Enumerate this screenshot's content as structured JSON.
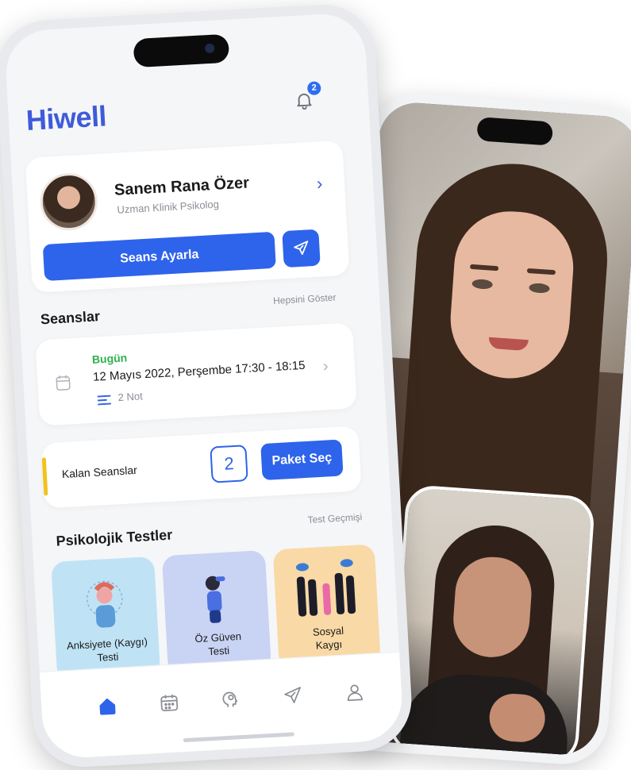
{
  "app": {
    "logo": "Hiwell",
    "notification_count": "2"
  },
  "psychologist": {
    "name": "Sanem Rana Özer",
    "title": "Uzman Klinik Psikolog",
    "chevron": "›"
  },
  "actions": {
    "schedule_label": "Seans Ayarla",
    "send_icon": "send-icon"
  },
  "sessions": {
    "title": "Seanslar",
    "see_all": "Hepsini Göster",
    "next": {
      "day_label": "Bugün",
      "date_time": "12 Mayıs 2022, Perşembe 17:30 - 18:15",
      "notes": "2 Not",
      "chevron": "›"
    }
  },
  "remaining": {
    "label": "Kalan Seanslar",
    "count": "2",
    "package_button": "Paket Seç"
  },
  "tests": {
    "title": "Psikolojik Testler",
    "history_link": "Test Geçmişi",
    "items": [
      {
        "label_line1": "Anksiyete (Kaygı)",
        "label_line2": "Testi",
        "color": "#bfe3f5"
      },
      {
        "label_line1": "Öz Güven",
        "label_line2": "Testi",
        "color": "#c9d3f4"
      },
      {
        "label_line1": "Sosyal",
        "label_line2": "Kaygı",
        "color": "#f9d9a6"
      }
    ]
  },
  "tabbar": {
    "items": [
      "home-icon",
      "calendar-icon",
      "head-icon",
      "send-icon",
      "profile-icon"
    ],
    "active": "home-icon"
  },
  "colors": {
    "primary": "#2e63eb",
    "logo": "#3f5bd9",
    "accent_today": "#2bb24c",
    "remaining_bar": "#f2c21f"
  }
}
